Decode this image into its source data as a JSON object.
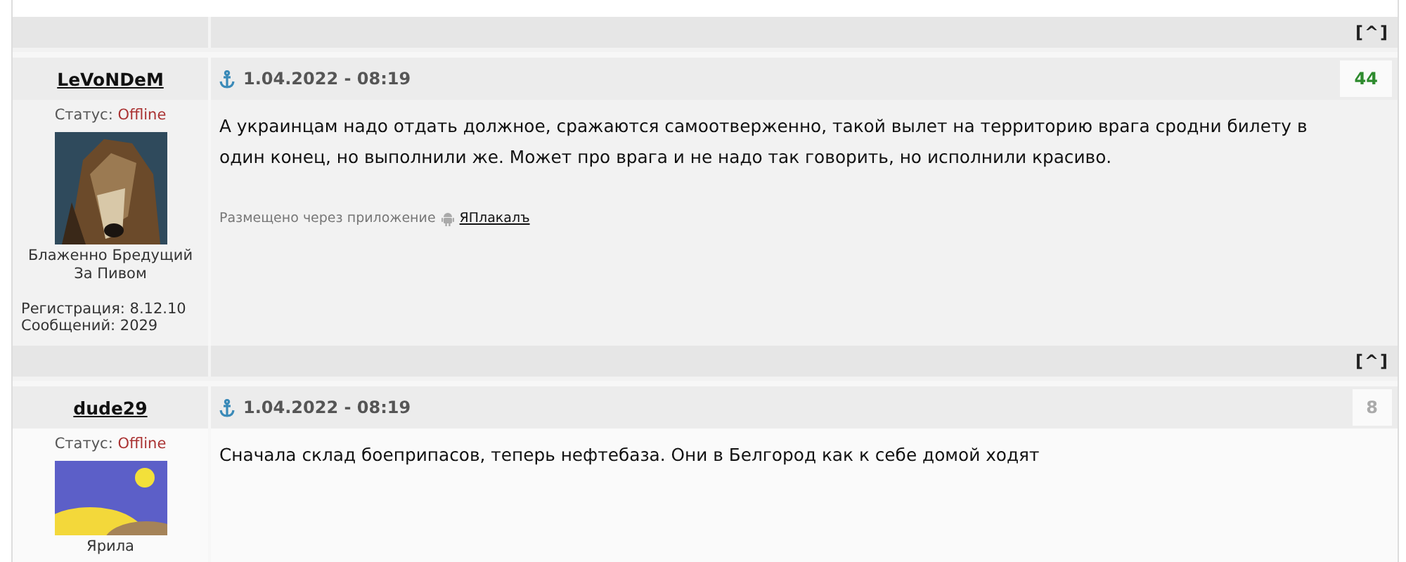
{
  "posts": [
    {
      "top_link": "[^]",
      "username": "LeVoNDeM",
      "date": "1.04.2022 - 08:19",
      "rating": "44",
      "color": "#2e8b2e",
      "status_label": "Статус:",
      "status": "Offline",
      "title": "Блаженно Бредущий За Пивом",
      "registration": "Регистрация: 8.12.10",
      "messages": "Сообщений: 2029",
      "text": "А украинцам надо отдать должное, сражаются самоотверженно, такой вылет на территорию врага сродни билету в один конец, но выполнили же. Может про врага и не надо так говорить, но исполнили красиво.",
      "via": {
        "label": "Размещено через приложение",
        "link": "ЯПлакалъ"
      }
    },
    {
      "top_link": "[^]",
      "username": "dude29",
      "date": "1.04.2022 - 08:19",
      "rating": "8",
      "color": "#aaaaaa",
      "status_label": "Статус:",
      "status": "Offline",
      "title": "Ярила",
      "text": "Сначала склад боеприпасов, теперь нефтебаза. Они в Белгород как к себе домой ходят"
    }
  ]
}
